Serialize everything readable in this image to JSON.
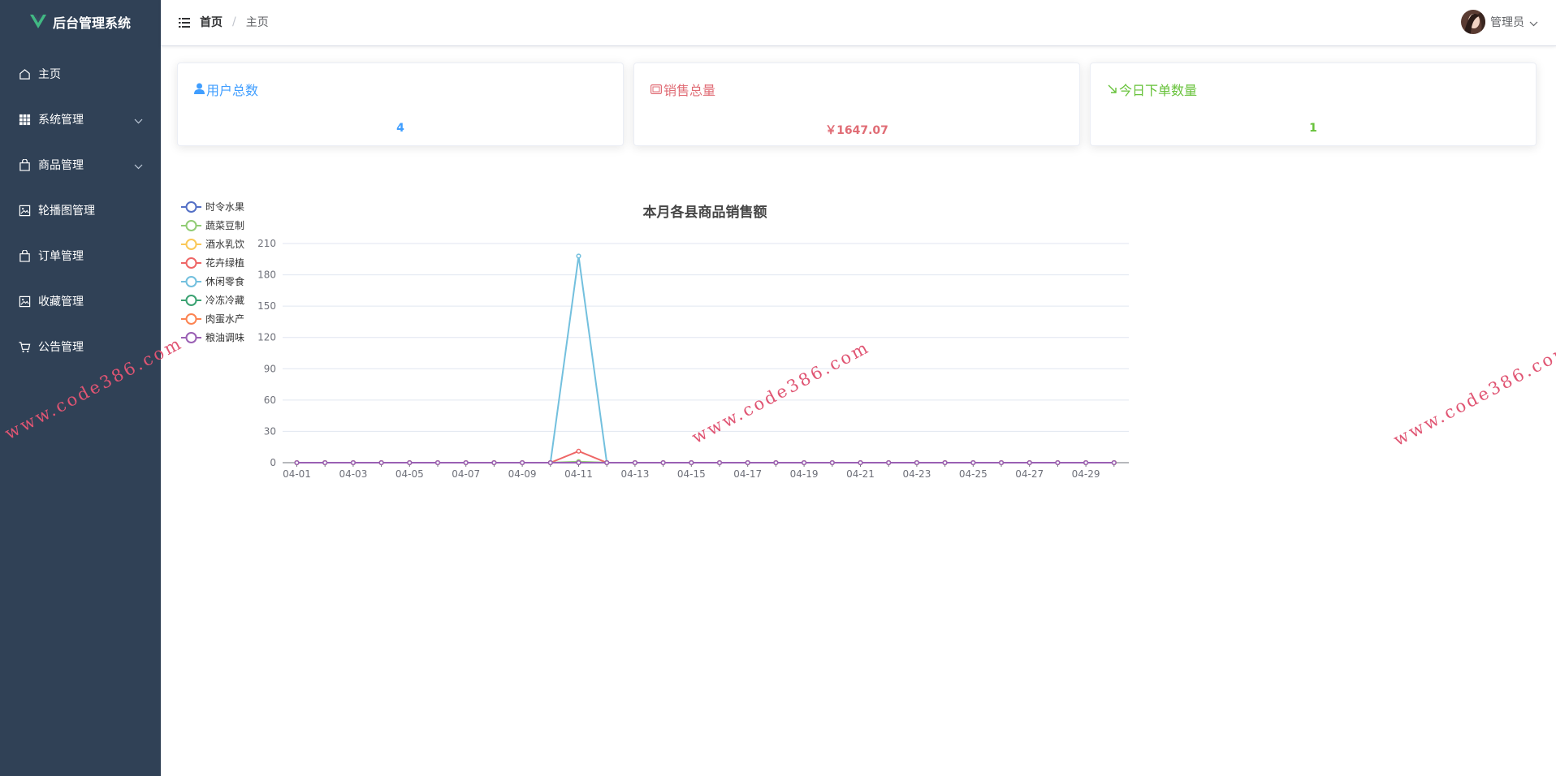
{
  "app": {
    "title": "后台管理系统"
  },
  "sidebar": {
    "items": [
      {
        "label": "主页",
        "icon": "home-icon"
      },
      {
        "label": "系统管理",
        "icon": "grid-icon",
        "has_children": true
      },
      {
        "label": "商品管理",
        "icon": "bag-icon",
        "has_children": true
      },
      {
        "label": "轮播图管理",
        "icon": "image-icon"
      },
      {
        "label": "订单管理",
        "icon": "bag-icon"
      },
      {
        "label": "收藏管理",
        "icon": "image-icon"
      },
      {
        "label": "公告管理",
        "icon": "cart-icon"
      }
    ]
  },
  "header": {
    "breadcrumb": [
      "首页",
      "主页"
    ],
    "user": {
      "name": "管理员"
    }
  },
  "cards": [
    {
      "title": "用户总数",
      "value": "4",
      "icon": "user-icon",
      "color": "#409eff"
    },
    {
      "title": "销售总量",
      "value": "￥1647.07",
      "icon": "wallet-icon",
      "color": "#e06c75"
    },
    {
      "title": "今日下单数量",
      "value": "1",
      "icon": "arrow-down-right-icon",
      "color": "#67c23a"
    }
  ],
  "watermark": "www.code386.com",
  "chart_data": {
    "type": "line",
    "title": "本月各县商品销售额",
    "xlabel": "",
    "ylabel": "",
    "ylim": [
      0,
      210
    ],
    "yticks": [
      0,
      30,
      60,
      90,
      120,
      150,
      180,
      210
    ],
    "grid": true,
    "legend_position": "top-left",
    "x": [
      "04-01",
      "04-02",
      "04-03",
      "04-04",
      "04-05",
      "04-06",
      "04-07",
      "04-08",
      "04-09",
      "04-10",
      "04-11",
      "04-12",
      "04-13",
      "04-14",
      "04-15",
      "04-16",
      "04-17",
      "04-18",
      "04-19",
      "04-20",
      "04-21",
      "04-22",
      "04-23",
      "04-24",
      "04-25",
      "04-26",
      "04-27",
      "04-28",
      "04-29",
      "04-30"
    ],
    "xtick_labels": [
      "04-01",
      "04-03",
      "04-05",
      "04-07",
      "04-09",
      "04-11",
      "04-13",
      "04-15",
      "04-17",
      "04-19",
      "04-21",
      "04-23",
      "04-25",
      "04-27",
      "04-29"
    ],
    "series": [
      {
        "name": "时令水果",
        "color": "#5470c6",
        "values": [
          0,
          0,
          0,
          0,
          0,
          0,
          0,
          0,
          0,
          0,
          0,
          0,
          0,
          0,
          0,
          0,
          0,
          0,
          0,
          0,
          0,
          0,
          0,
          0,
          0,
          0,
          0,
          0,
          0,
          0
        ]
      },
      {
        "name": "蔬菜豆制",
        "color": "#91cc75",
        "values": [
          0,
          0,
          0,
          0,
          0,
          0,
          0,
          0,
          0,
          0,
          1,
          0,
          0,
          0,
          0,
          0,
          0,
          0,
          0,
          0,
          0,
          0,
          0,
          0,
          0,
          0,
          0,
          0,
          0,
          0
        ]
      },
      {
        "name": "酒水乳饮",
        "color": "#fac858",
        "values": [
          0,
          0,
          0,
          0,
          0,
          0,
          0,
          0,
          0,
          0,
          0,
          0,
          0,
          0,
          0,
          0,
          0,
          0,
          0,
          0,
          0,
          0,
          0,
          0,
          0,
          0,
          0,
          0,
          0,
          0
        ]
      },
      {
        "name": "花卉绿植",
        "color": "#ee6666",
        "values": [
          0,
          0,
          0,
          0,
          0,
          0,
          0,
          0,
          0,
          0,
          11,
          0,
          0,
          0,
          0,
          0,
          0,
          0,
          0,
          0,
          0,
          0,
          0,
          0,
          0,
          0,
          0,
          0,
          0,
          0
        ]
      },
      {
        "name": "休闲零食",
        "color": "#73c0de",
        "values": [
          0,
          0,
          0,
          0,
          0,
          0,
          0,
          0,
          0,
          0,
          198,
          0,
          0,
          0,
          0,
          0,
          0,
          0,
          0,
          0,
          0,
          0,
          0,
          0,
          0,
          0,
          0,
          0,
          0,
          0
        ]
      },
      {
        "name": "冷冻冷藏",
        "color": "#3ba272",
        "values": [
          0,
          0,
          0,
          0,
          0,
          0,
          0,
          0,
          0,
          0,
          0,
          0,
          0,
          0,
          0,
          0,
          0,
          0,
          0,
          0,
          0,
          0,
          0,
          0,
          0,
          0,
          0,
          0,
          0,
          0
        ]
      },
      {
        "name": "肉蛋水产",
        "color": "#fc8452",
        "values": [
          0,
          0,
          0,
          0,
          0,
          0,
          0,
          0,
          0,
          0,
          0,
          0,
          0,
          0,
          0,
          0,
          0,
          0,
          0,
          0,
          0,
          0,
          0,
          0,
          0,
          0,
          0,
          0,
          0,
          0
        ]
      },
      {
        "name": "粮油调味",
        "color": "#9a60b4",
        "values": [
          0,
          0,
          0,
          0,
          0,
          0,
          0,
          0,
          0,
          0,
          0,
          0,
          0,
          0,
          0,
          0,
          0,
          0,
          0,
          0,
          0,
          0,
          0,
          0,
          0,
          0,
          0,
          0,
          0,
          0
        ]
      }
    ]
  }
}
